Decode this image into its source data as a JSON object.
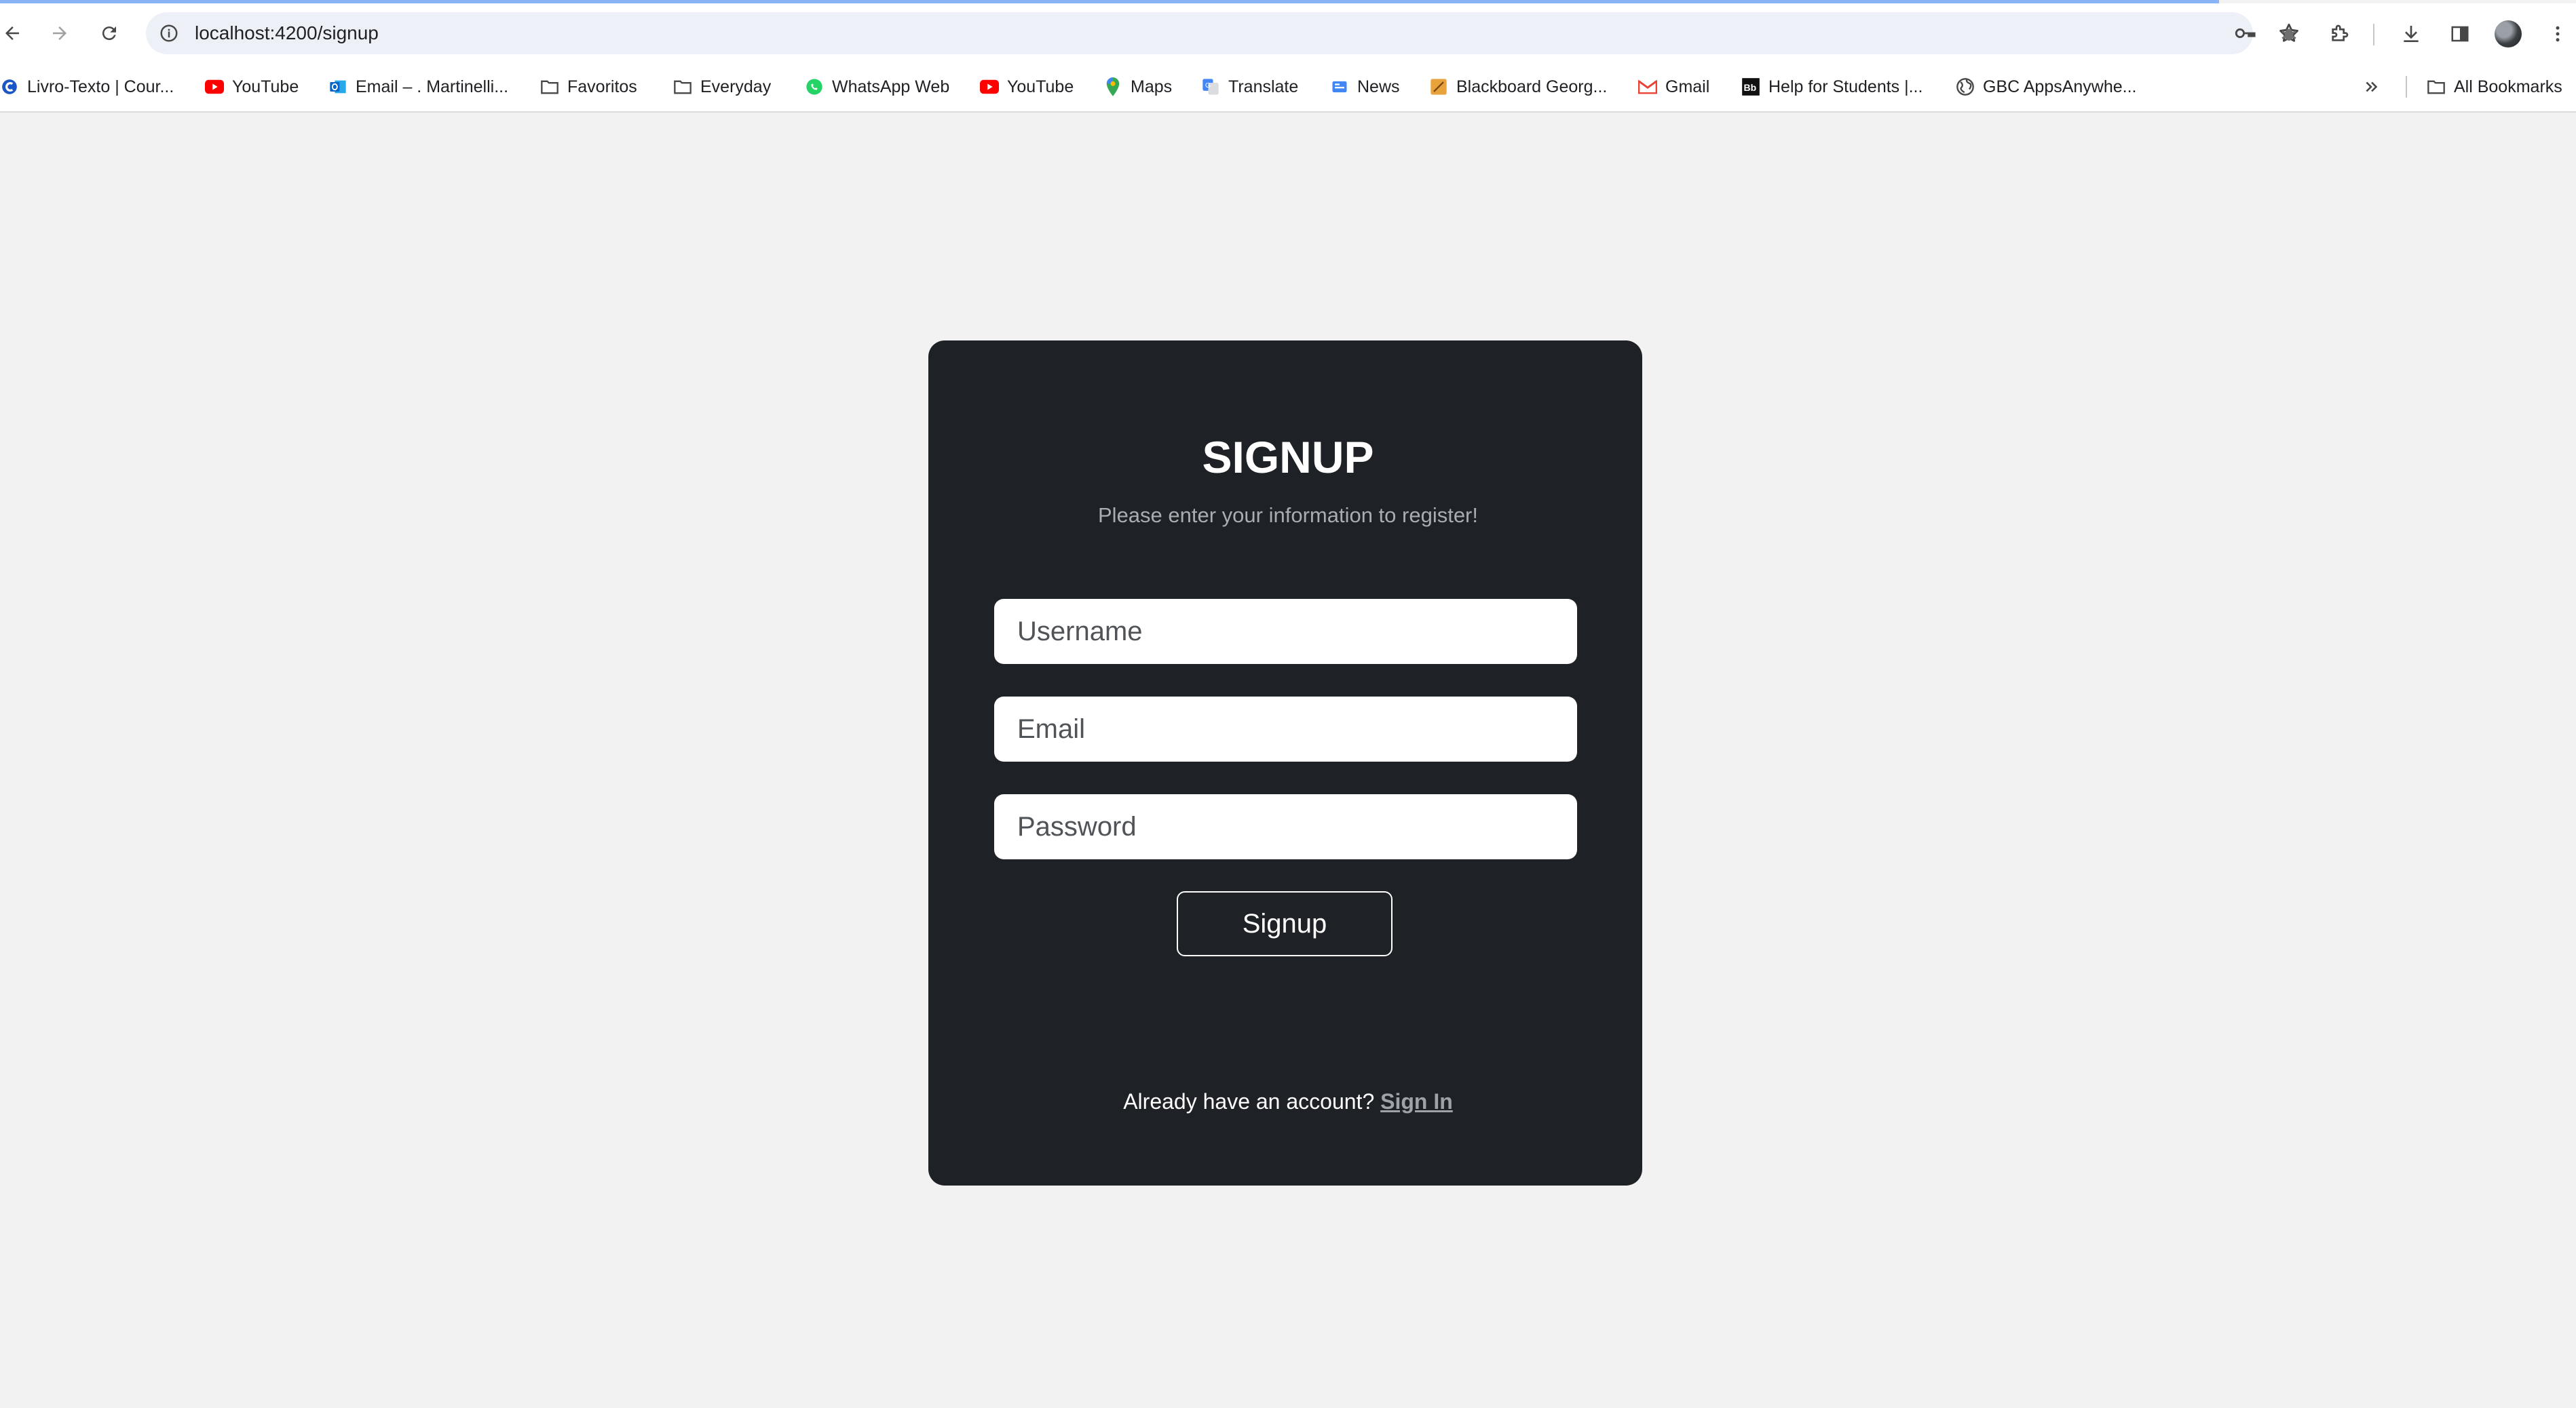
{
  "browser": {
    "url": "localhost:4200/signup",
    "bookmarks": [
      {
        "label": "Livro-Texto | Cour...",
        "icon": "c-logo-icon"
      },
      {
        "label": "YouTube",
        "icon": "youtube-icon"
      },
      {
        "label": "Email – . Martinelli...",
        "icon": "outlook-icon"
      },
      {
        "label": "Favoritos",
        "icon": "folder-icon"
      },
      {
        "label": "Everyday",
        "icon": "folder-icon"
      },
      {
        "label": "WhatsApp Web",
        "icon": "whatsapp-icon"
      },
      {
        "label": "YouTube",
        "icon": "youtube-icon"
      },
      {
        "label": "Maps",
        "icon": "maps-icon"
      },
      {
        "label": "Translate",
        "icon": "translate-icon"
      },
      {
        "label": "News",
        "icon": "news-icon"
      },
      {
        "label": "Blackboard Georg...",
        "icon": "blackboard-icon"
      },
      {
        "label": "Gmail",
        "icon": "gmail-icon"
      },
      {
        "label": "Help for Students |...",
        "icon": "bb-icon"
      },
      {
        "label": "GBC AppsAnywhe...",
        "icon": "globe-icon"
      }
    ],
    "all_bookmarks": "All Bookmarks"
  },
  "signup": {
    "title": "SIGNUP",
    "subtitle": "Please enter your information to register!",
    "username_placeholder": "Username",
    "email_placeholder": "Email",
    "password_placeholder": "Password",
    "button_label": "Signup",
    "footer_text": "Already have an account?",
    "signin_link": "Sign In"
  },
  "colors": {
    "page_bg": "#f2f2f2",
    "card_bg": "#1e2125",
    "subtitle": "#a9acb0",
    "link": "#9fa3a8"
  }
}
